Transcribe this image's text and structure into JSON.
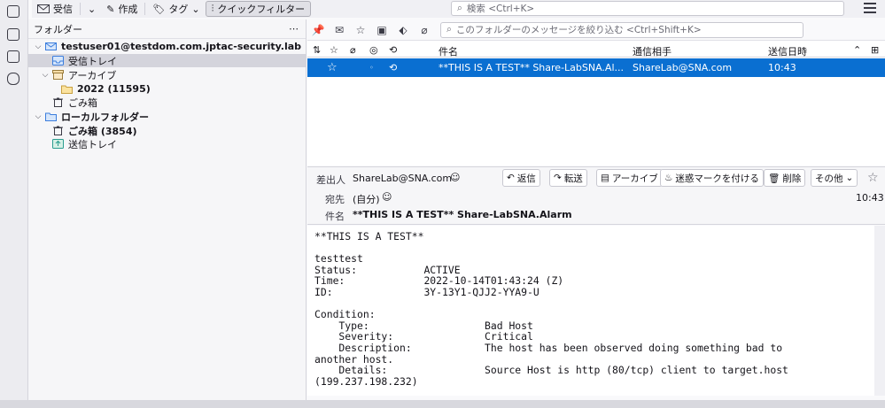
{
  "toolbar": {
    "get_messages": "受信",
    "compose": "作成",
    "tag": "タグ",
    "quick_filter": "クイックフィルター",
    "search_placeholder": "検索 <Ctrl+K>"
  },
  "folder_pane": {
    "title": "フォルダー",
    "more": "⋯",
    "folders": [
      {
        "label": "testuser01@testdom.com.jptac-security.lab",
        "icon": "account-icon"
      },
      {
        "label": "受信トレイ",
        "icon": "inbox-icon"
      },
      {
        "label": "アーカイブ",
        "icon": "archive-icon"
      },
      {
        "label": "2022 (11595)",
        "icon": "folder-icon"
      },
      {
        "label": "ごみ箱",
        "icon": "trash-icon"
      },
      {
        "label": "ローカルフォルダー",
        "icon": "folder-icon"
      },
      {
        "label": "ごみ箱 (3854)",
        "icon": "trash-icon"
      },
      {
        "label": "送信トレイ",
        "icon": "outbox-icon"
      }
    ]
  },
  "message_list": {
    "quick_filter_placeholder": "このフォルダーのメッセージを絞り込む <Ctrl+Shift+K>",
    "columns": {
      "subject": "件名",
      "correspondent": "通信相手",
      "date": "送信日時"
    },
    "rows": [
      {
        "subject": "**THIS IS A TEST** Share-LabSNA.Al...",
        "correspondent": "ShareLab@SNA.com",
        "date": "10:43"
      }
    ]
  },
  "message_header": {
    "from_label": "差出人",
    "from_value": "ShareLab@SNA.com",
    "to_label": "宛先",
    "to_value": "(自分)",
    "subject_label": "件名",
    "subject_value": "**THIS IS A TEST** Share-LabSNA.Alarm",
    "time": "10:43",
    "actions": {
      "reply": "返信",
      "forward": "転送",
      "archive": "アーカイブ",
      "junk": "迷惑マークを付ける",
      "delete": "削除",
      "other": "その他"
    }
  },
  "message_body": {
    "text": "**THIS IS A TEST**\n\ntesttest\nStatus:           ACTIVE\nTime:             2022-10-14T01:43:24 (Z)\nID:               3Y-13Y1-QJJ2-YYA9-U\n\nCondition:\n    Type:                   Bad Host\n    Severity:               Critical\n    Description:            The host has been observed doing something bad to\nanother host.\n    Details:                Source Host is http (80/tcp) client to target.host\n(199.237.198.232)"
  },
  "colors": {
    "selection": "#0a6fd1",
    "accent": "#0a6fd1"
  }
}
